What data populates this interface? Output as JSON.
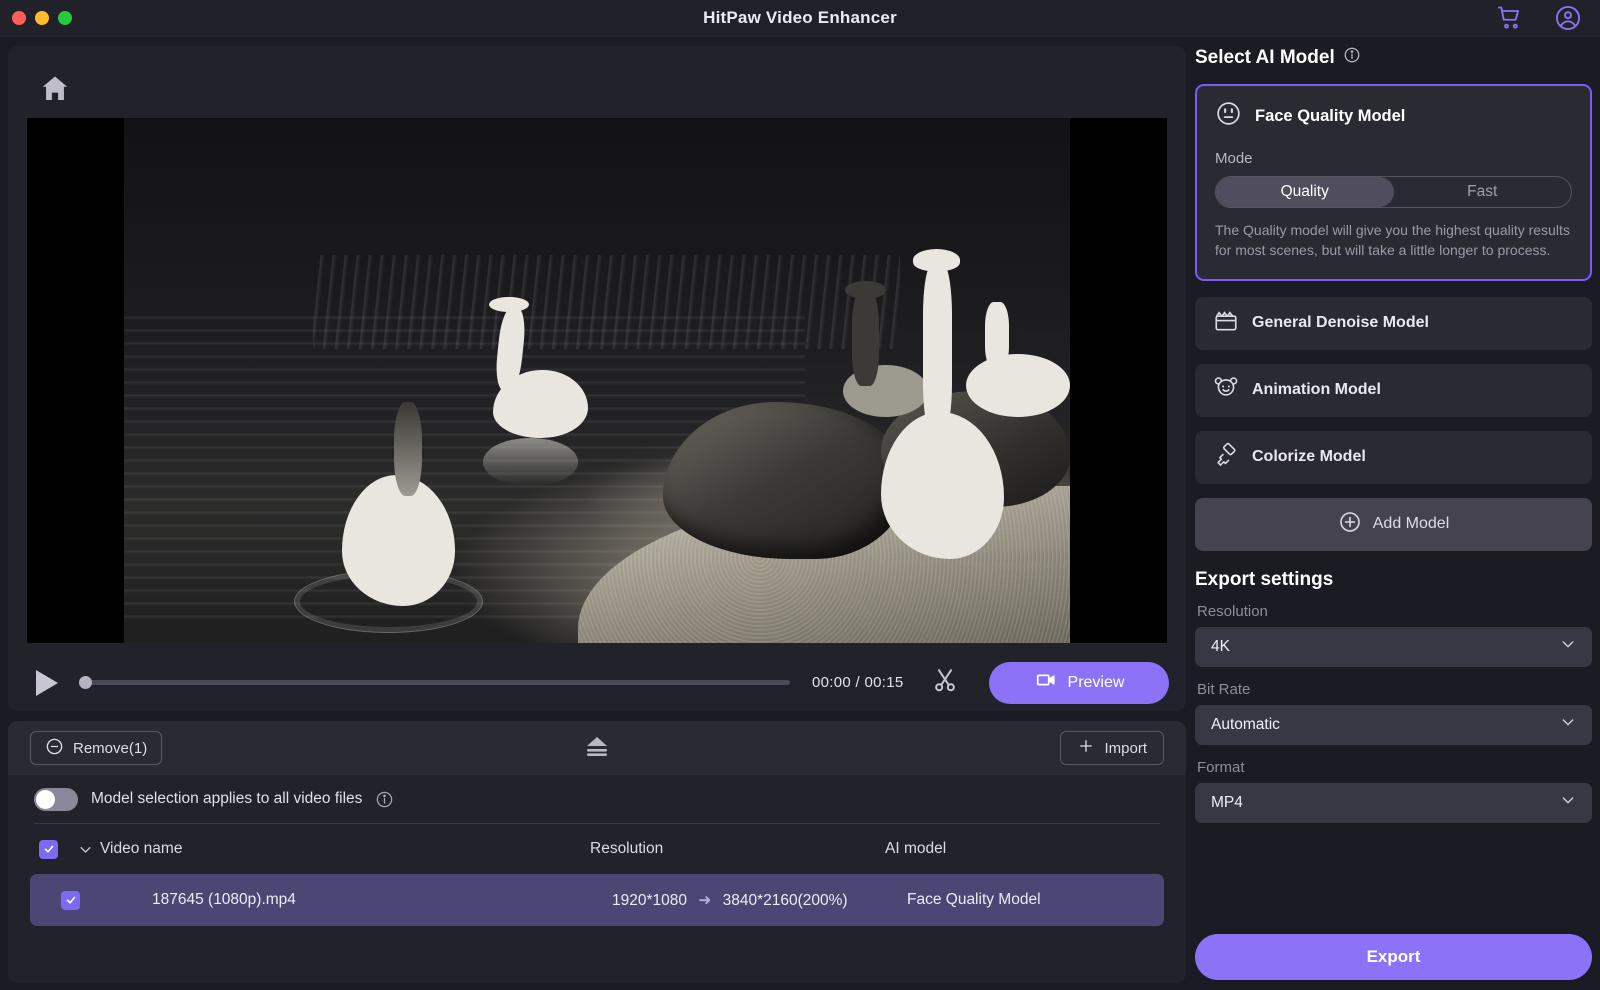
{
  "window": {
    "title": "HitPaw Video Enhancer",
    "traffic_lights": [
      "close",
      "minimize",
      "maximize"
    ],
    "cart_icon": "cart-icon",
    "account_icon": "account-icon"
  },
  "player": {
    "home_icon": "home-icon",
    "play_icon": "play-icon",
    "timecode": "00:00 / 00:15",
    "current_time": "00:00",
    "duration": "00:15",
    "progress_percent": 0,
    "cut_icon": "scissors-icon",
    "preview_label": "Preview",
    "preview_icon": "video-camera-icon"
  },
  "file_list": {
    "remove_label": "Remove(1)",
    "remove_icon": "minus-circle-icon",
    "eject_icon": "eject-icon",
    "import_label": "Import",
    "import_icon": "plus-icon",
    "apply_all_label": "Model selection applies to all video files",
    "apply_all_info_icon": "info-icon",
    "apply_all_enabled": false,
    "columns": [
      "Video name",
      "Resolution",
      "AI model"
    ],
    "rows": [
      {
        "checked": true,
        "name": "187645 (1080p).mp4",
        "resolution_from": "1920*1080",
        "resolution_arrow": "➜",
        "resolution_to": "3840*2160(200%)",
        "ai_model": "Face Quality Model"
      }
    ],
    "header_checked": true,
    "header_chevron": "chevron-down-icon"
  },
  "ai_panel": {
    "title": "Select AI Model",
    "title_info_icon": "info-icon",
    "selected_model": {
      "name": "Face Quality Model",
      "icon": "face-icon",
      "mode_label": "Mode",
      "modes": [
        "Quality",
        "Fast"
      ],
      "active_mode": "Quality",
      "description": "The Quality model will give you the highest quality results for most scenes, but will take a little longer to process."
    },
    "models": [
      {
        "name": "General Denoise Model",
        "icon": "clapperboard-icon"
      },
      {
        "name": "Animation Model",
        "icon": "bear-face-icon"
      },
      {
        "name": "Colorize Model",
        "icon": "paint-roller-icon"
      }
    ],
    "add_model_label": "Add Model",
    "add_model_icon": "plus-circle-icon"
  },
  "export": {
    "title": "Export settings",
    "resolution_label": "Resolution",
    "resolution_value": "4K",
    "bitrate_label": "Bit Rate",
    "bitrate_value": "Automatic",
    "format_label": "Format",
    "format_value": "MP4",
    "export_label": "Export",
    "chevron_icon": "chevron-down-icon"
  },
  "colors": {
    "accent": "#8b72f7",
    "selected_border": "#7c5cf5",
    "row_selected": "#4b4673",
    "checkbox": "#7b6bf0",
    "panel_bg": "#2a2a33",
    "app_bg": "#1b1b23"
  }
}
